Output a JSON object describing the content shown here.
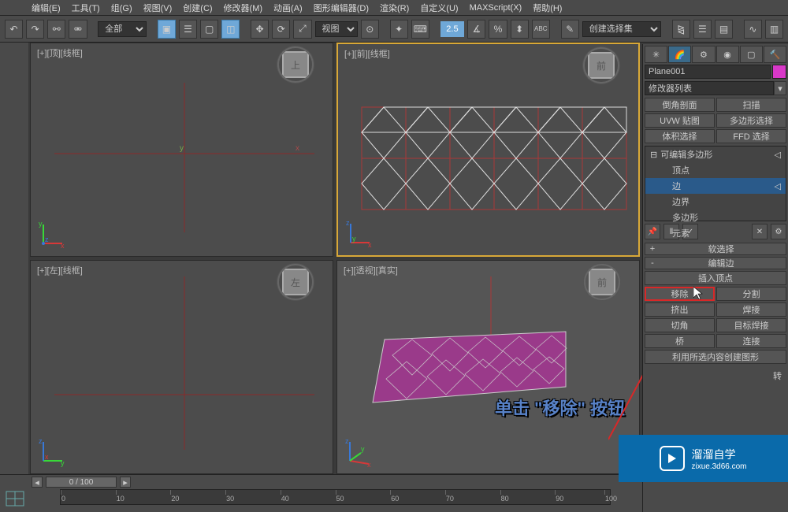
{
  "menu": {
    "edit": "编辑(E)",
    "tools": "工具(T)",
    "group": "组(G)",
    "views": "视图(V)",
    "create": "创建(C)",
    "modifiers": "修改器(M)",
    "animation": "动画(A)",
    "grapheditors": "图形编辑器(D)",
    "rendering": "渲染(R)",
    "customize": "自定义(U)",
    "maxscript": "MAXScript(X)",
    "help": "帮助(H)"
  },
  "toolbar": {
    "filter_all": "全部",
    "coord_sys": "视图",
    "spinner_value": "2.5",
    "selection_set": "创建选择集"
  },
  "viewports": {
    "top": {
      "label": "[+][顶][线框]",
      "cube": "上"
    },
    "front": {
      "label": "[+][前][线框]",
      "cube": "前"
    },
    "left": {
      "label": "[+][左][线框]",
      "cube": "左"
    },
    "perspective": {
      "label": "[+][透视][真实]",
      "cube": "前"
    }
  },
  "axis": {
    "x": "x",
    "y": "y",
    "z": "z"
  },
  "cmdpanel": {
    "object_name": "Plane001",
    "mod_list_prompt": "修改器列表",
    "buttons": {
      "chamfer_profile": "倒角剖面",
      "sweep": "扫描",
      "uvw_map": "UVW 贴图",
      "poly_select": "多边形选择",
      "vol_select": "体积选择",
      "ffd_select": "FFD 选择"
    },
    "stack": {
      "editable_poly": "可编辑多边形",
      "vertex": "顶点",
      "edge": "边",
      "border": "边界",
      "polygon": "多边形",
      "element": "元素"
    },
    "rollouts": {
      "soft_sel": "软选择",
      "edit_edges": "编辑边",
      "insert_vertex": "插入顶点",
      "remove": "移除",
      "split": "分割",
      "extrude": "挤出",
      "weld": "焊接",
      "chamfer": "切角",
      "target_weld": "目标焊接",
      "bridge": "桥",
      "connect": "连接",
      "create_shape": "利用所选内容创建图形",
      "rotate_suffix": "转"
    }
  },
  "timeline": {
    "slider": "0 / 100",
    "ticks": [
      "0",
      "10",
      "20",
      "30",
      "40",
      "50",
      "60",
      "70",
      "80",
      "90",
      "100"
    ]
  },
  "annotation": "单击 \"移除\" 按钮",
  "watermark": {
    "title": "溜溜自学",
    "sub": "zixue.3d66.com"
  }
}
